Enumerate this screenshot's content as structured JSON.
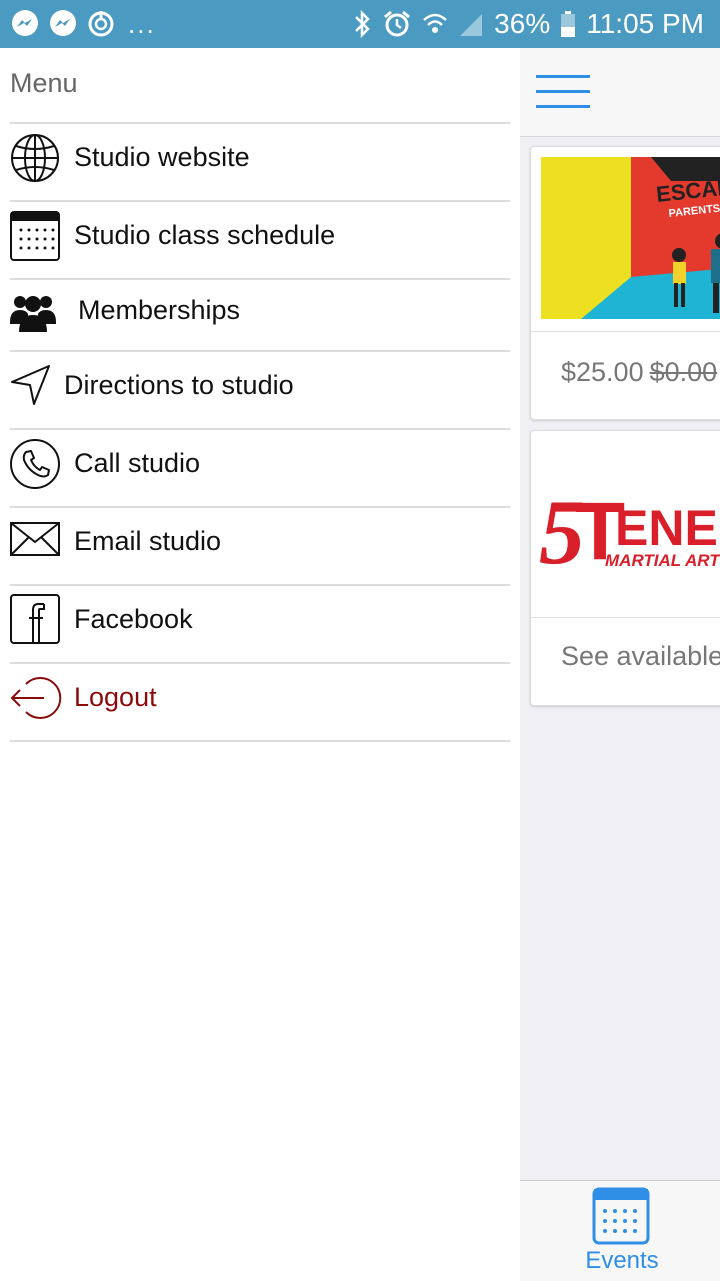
{
  "status_bar": {
    "battery": "36%",
    "time": "11:05 PM",
    "more": "...",
    "icons": [
      "messenger-icon",
      "messenger-icon",
      "sync-icon",
      "bluetooth-icon",
      "alarm-icon",
      "wifi-icon",
      "signal-icon",
      "battery-icon"
    ]
  },
  "drawer": {
    "title": "Menu",
    "items": [
      {
        "label": "Studio website",
        "icon": "globe-icon"
      },
      {
        "label": "Studio class schedule",
        "icon": "calendar-icon"
      },
      {
        "label": "Memberships",
        "icon": "users-icon"
      },
      {
        "label": "Directions to studio",
        "icon": "navigation-arrow-icon"
      },
      {
        "label": "Call studio",
        "icon": "phone-icon"
      },
      {
        "label": "Email studio",
        "icon": "envelope-icon"
      },
      {
        "label": "Facebook",
        "icon": "facebook-icon"
      },
      {
        "label": "Logout",
        "icon": "logout-icon"
      }
    ]
  },
  "background_app": {
    "cards": [
      {
        "image_text": [
          "ESCAPE",
          "PARENTS N"
        ],
        "price": "$25.00",
        "original_price": "$0.00"
      },
      {
        "logo_text": [
          "5",
          "T",
          "ENE",
          "MARTIAL ARTS"
        ],
        "footer": "See available"
      }
    ],
    "tab_bar": {
      "label": "Events",
      "icon": "calendar-icon"
    }
  },
  "colors": {
    "status_bar": "#4a9ac1",
    "accent": "#2f8ee6",
    "logout": "#8b0b0b",
    "logo_red": "#d81f2a"
  }
}
